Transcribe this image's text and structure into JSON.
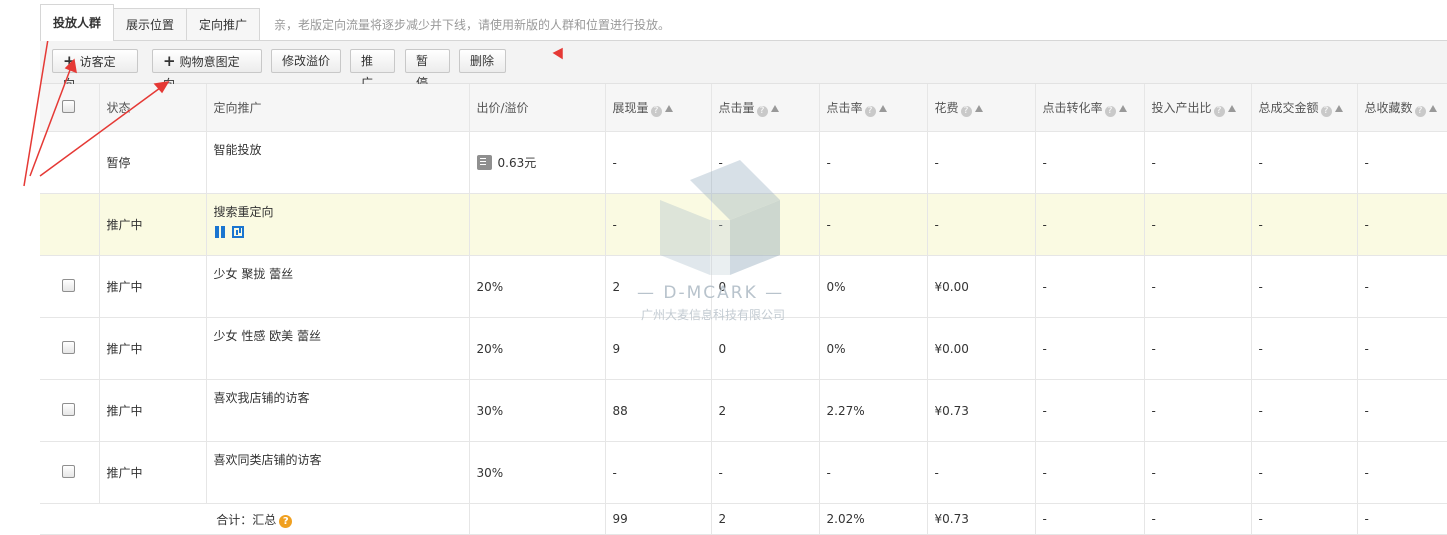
{
  "tabs": [
    "投放人群",
    "展示位置",
    "定向推广"
  ],
  "notice": "亲，老版定向流量将逐步减少并下线，请使用新版的人群和位置进行投放。",
  "toolbar": {
    "visitor_btn": "访客定向",
    "intent_btn": "购物意图定向",
    "edit_premium_btn": "修改溢价",
    "promote_btn": "推广",
    "pause_btn": "暂停",
    "delete_btn": "删除"
  },
  "columns": {
    "status": "状态",
    "target": "定向推广",
    "bid": "出价/溢价",
    "impressions": "展现量",
    "clicks": "点击量",
    "ctr": "点击率",
    "cost": "花费",
    "cvr": "点击转化率",
    "roi": "投入产出比",
    "gmv": "总成交金额",
    "favorites": "总收藏数"
  },
  "rows": [
    {
      "status": "暂停",
      "name": "智能投放",
      "bid": "0.63元",
      "impressions": "-",
      "clicks": "-",
      "ctr": "-",
      "cost": "-",
      "cvr": "-",
      "roi": "-",
      "gmv": "-",
      "favorites": "-"
    },
    {
      "status": "推广中",
      "name": "搜索重定向",
      "bid": "",
      "impressions": "-",
      "clicks": "-",
      "ctr": "-",
      "cost": "-",
      "cvr": "-",
      "roi": "-",
      "gmv": "-",
      "favorites": "-"
    },
    {
      "status": "推广中",
      "name": "少女 聚拢 蕾丝",
      "bid": "20%",
      "impressions": "2",
      "clicks": "0",
      "ctr": "0%",
      "cost": "¥0.00",
      "cvr": "-",
      "roi": "-",
      "gmv": "-",
      "favorites": "-"
    },
    {
      "status": "推广中",
      "name": "少女 性感 欧美 蕾丝",
      "bid": "20%",
      "impressions": "9",
      "clicks": "0",
      "ctr": "0%",
      "cost": "¥0.00",
      "cvr": "-",
      "roi": "-",
      "gmv": "-",
      "favorites": "-"
    },
    {
      "status": "推广中",
      "name": "喜欢我店铺的访客",
      "bid": "30%",
      "impressions": "88",
      "clicks": "2",
      "ctr": "2.27%",
      "cost": "¥0.73",
      "cvr": "-",
      "roi": "-",
      "gmv": "-",
      "favorites": "-"
    },
    {
      "status": "推广中",
      "name": "喜欢同类店铺的访客",
      "bid": "30%",
      "impressions": "-",
      "clicks": "-",
      "ctr": "-",
      "cost": "-",
      "cvr": "-",
      "roi": "-",
      "gmv": "-",
      "favorites": "-"
    }
  ],
  "total": {
    "label": "合计：汇总",
    "impressions": "99",
    "clicks": "2",
    "ctr": "2.02%",
    "cost": "¥0.73",
    "cvr": "-",
    "roi": "-",
    "gmv": "-",
    "favorites": "-"
  },
  "watermark": {
    "brand": "— D-MCARK —",
    "company": "广州大麦信息科技有限公司"
  },
  "colors": {
    "active_status": "#2d9a1d",
    "paused_status": "#e28117",
    "highlight_row": "#fafae2",
    "arrow": "#e53935"
  }
}
